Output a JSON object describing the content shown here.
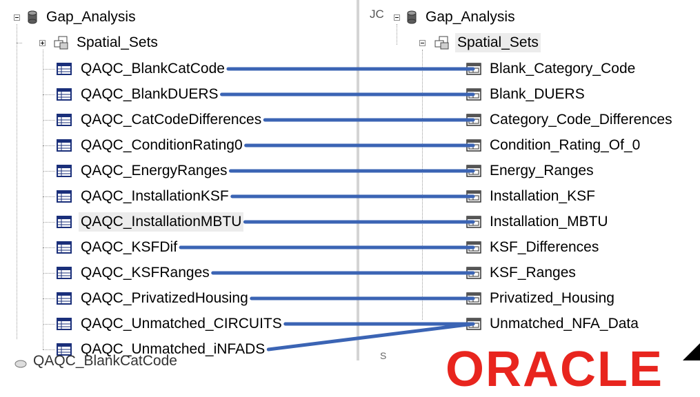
{
  "left_tree": {
    "root": {
      "label": "Gap_Analysis",
      "icon": "database-icon",
      "expander": "minus"
    },
    "child": {
      "label": "Spatial_Sets",
      "icon": "spatial-sets-icon",
      "expander": "plus"
    },
    "tables": [
      {
        "label": "QAQC_BlankCatCode",
        "selected": false
      },
      {
        "label": "QAQC_BlankDUERS",
        "selected": false
      },
      {
        "label": "QAQC_CatCodeDifferences",
        "selected": false
      },
      {
        "label": "QAQC_ConditionRating0",
        "selected": false
      },
      {
        "label": "QAQC_EnergyRanges",
        "selected": false
      },
      {
        "label": "QAQC_InstallationKSF",
        "selected": false
      },
      {
        "label": "QAQC_InstallationMBTU",
        "selected": true
      },
      {
        "label": "QAQC_KSFDif",
        "selected": false
      },
      {
        "label": "QAQC_KSFRanges",
        "selected": false
      },
      {
        "label": "QAQC_PrivatizedHousing",
        "selected": false
      },
      {
        "label": "QAQC_Unmatched_CIRCUITS",
        "selected": false
      },
      {
        "label": "QAQC_Unmatched_iNFADS",
        "selected": false
      }
    ],
    "next_partial_label": "QAQC_BlankCatCode"
  },
  "right_tree": {
    "prefix": "JC",
    "root": {
      "label": "Gap_Analysis",
      "icon": "database-icon",
      "expander": "minus"
    },
    "child": {
      "label": "Spatial_Sets",
      "icon": "spatial-sets-icon",
      "expander": "minus",
      "selected": true
    },
    "views": [
      {
        "label": "Blank_Category_Code"
      },
      {
        "label": "Blank_DUERS"
      },
      {
        "label": "Category_Code_Differences"
      },
      {
        "label": "Condition_Rating_Of_0"
      },
      {
        "label": "Energy_Ranges"
      },
      {
        "label": "Installation_KSF"
      },
      {
        "label": "Installation_MBTU"
      },
      {
        "label": "KSF_Differences"
      },
      {
        "label": "KSF_Ranges"
      },
      {
        "label": "Privatized_Housing"
      },
      {
        "label": "Unmatched_NFA_Data"
      }
    ]
  },
  "mappings": [
    {
      "from": "QAQC_BlankCatCode",
      "to": "Blank_Category_Code"
    },
    {
      "from": "QAQC_BlankDUERS",
      "to": "Blank_DUERS"
    },
    {
      "from": "QAQC_CatCodeDifferences",
      "to": "Category_Code_Differences"
    },
    {
      "from": "QAQC_ConditionRating0",
      "to": "Condition_Rating_Of_0"
    },
    {
      "from": "QAQC_EnergyRanges",
      "to": "Energy_Ranges"
    },
    {
      "from": "QAQC_InstallationKSF",
      "to": "Installation_KSF"
    },
    {
      "from": "QAQC_InstallationMBTU",
      "to": "Installation_MBTU"
    },
    {
      "from": "QAQC_KSFDif",
      "to": "KSF_Differences"
    },
    {
      "from": "QAQC_KSFRanges",
      "to": "KSF_Ranges"
    },
    {
      "from": "QAQC_PrivatizedHousing",
      "to": "Privatized_Housing"
    },
    {
      "from": "QAQC_Unmatched_CIRCUITS",
      "to": "Unmatched_NFA_Data"
    },
    {
      "from": "QAQC_Unmatched_iNFADS",
      "to": "Unmatched_NFA_Data"
    }
  ],
  "footer": {
    "logo_text": "ORACLE",
    "small_mark": "S"
  },
  "colors": {
    "connector": "#3b64b4",
    "selection": "#ececec",
    "oracle_red": "#e8251e"
  }
}
